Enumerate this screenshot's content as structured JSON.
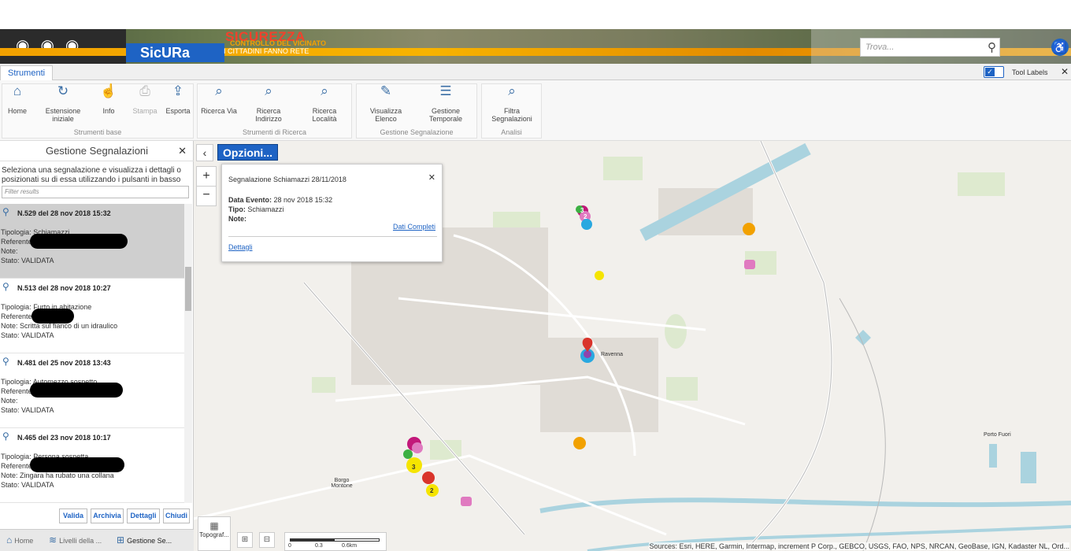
{
  "banner": {
    "logo": "SicURa",
    "title": "SICUREZZA",
    "subtitle": "CONTROLLO DEL VICINATO",
    "tagline": "I CITTADINI FANNO RETE",
    "search_placeholder": "Trova..."
  },
  "tabs": [
    "Strumenti"
  ],
  "tool_labels": "Tool Labels",
  "ribbon": {
    "groups": [
      {
        "label": "Strumenti base",
        "buttons": [
          "Home",
          "Estensione iniziale",
          "Info",
          "Stampa",
          "Esporta"
        ]
      },
      {
        "label": "Strumenti di Ricerca",
        "buttons": [
          "Ricerca Via",
          "Ricerca Indirizzo",
          "Ricerca Località"
        ]
      },
      {
        "label": "Gestione Segnalazione",
        "buttons": [
          "Visualizza Elenco",
          "Gestione Temporale"
        ]
      },
      {
        "label": "Analisi",
        "buttons": [
          "Filtra Segnalazioni"
        ]
      }
    ]
  },
  "panel": {
    "title": "Gestione Segnalazioni",
    "description": "Seleziona una segnalazione e visualizza i dettagli o posizionati su di essa utilizzando i pulsanti in basso",
    "filter_placeholder": "Filter results",
    "items": [
      {
        "head": "N.529 del 28 nov 2018 15:32",
        "tipologia": "Tipologia: Schiamazzi",
        "referente": "Referente:",
        "note": "Note:",
        "stato": "Stato: VALIDATA"
      },
      {
        "head": "N.513 del 28 nov 2018 10:27",
        "tipologia": "Tipologia: Furto in abitazione",
        "referente": "Referente:",
        "note": "Note: Scritta sul fianco di un idraulico",
        "stato": "Stato: VALIDATA"
      },
      {
        "head": "N.481 del 25 nov 2018 13:43",
        "tipologia": "Tipologia: Automezzo sospetto",
        "referente": "Referente:",
        "note": "Note:",
        "stato": "Stato: VALIDATA"
      },
      {
        "head": "N.465 del 23 nov 2018 10:17",
        "tipologia": "Tipologia: Persona sospetta",
        "referente": "Referente:",
        "note": "Note: Zingara ha rubato una collana",
        "stato": "Stato: VALIDATA"
      }
    ],
    "buttons": [
      "Valida",
      "Archivia",
      "Dettagli",
      "Chiudi"
    ],
    "bottom_tabs": [
      "Home",
      "Livelli della ...",
      "Gestione Se..."
    ]
  },
  "map": {
    "options_button": "Opzioni...",
    "popup": {
      "title": "Segnalazione Schiamazzi 28/11/2018",
      "data_evento_label": "Data Evento:",
      "data_evento_value": "28 nov 2018 15:32",
      "tipo_label": "Tipo:",
      "tipo_value": "Schiamazzi",
      "note_label": "Note:",
      "link_full": "Dati Completi",
      "link_details": "Dettagli"
    },
    "basemap_label": "Topograf...",
    "scale": {
      "zero": "0",
      "mid": "0.3",
      "end": "0.6km"
    },
    "labels": {
      "city": "Ravenna",
      "borgo": "Borgo Montone",
      "porto": "Porto Fuori"
    },
    "cluster_counts": [
      "3",
      "2",
      "3",
      "2"
    ],
    "credits": "Sources: Esri, HERE, Garmin, Intermap, increment P Corp., GEBCO, USGS, FAO, NPS, NRCAN, GeoBase, IGN, Kadaster NL, Ord..."
  },
  "colors": {
    "accent": "#1e63c4",
    "banner_orange": "#f2a100",
    "sicurezza_red": "#f3412b",
    "marker_magenta": "#c2187a",
    "marker_yellow": "#f5e400",
    "marker_cyan": "#29a8e0",
    "marker_orange": "#f2a100"
  }
}
